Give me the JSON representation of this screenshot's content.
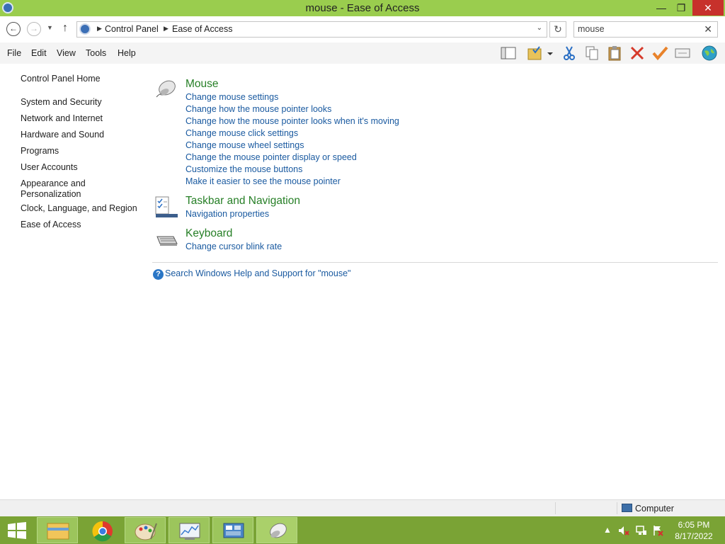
{
  "window": {
    "title": "mouse - Ease of Access",
    "minimize_glyph": "—",
    "maximize_glyph": "❐",
    "close_glyph": "✕"
  },
  "address": {
    "breadcrumbs": [
      "Control Panel",
      "Ease of Access"
    ],
    "search_value": "mouse"
  },
  "menu": [
    "File",
    "Edit",
    "View",
    "Tools",
    "Help"
  ],
  "toolbar_icons": [
    "layout-icon",
    "folder-options-icon",
    "cut-icon",
    "copy-icon",
    "paste-icon",
    "delete-icon",
    "checkmark-icon",
    "properties-icon",
    "globe-icon"
  ],
  "sidebar": {
    "home": "Control Panel Home",
    "items": [
      "System and Security",
      "Network and Internet",
      "Hardware and Sound",
      "Programs",
      "User Accounts",
      "Appearance and Personalization",
      "Clock, Language, and Region",
      "Ease of Access"
    ]
  },
  "results": [
    {
      "title": "Mouse",
      "icon": "mouse-icon",
      "links": [
        "Change mouse settings",
        "Change how the mouse pointer looks",
        "Change how the mouse pointer looks when it's moving",
        "Change mouse click settings",
        "Change mouse wheel settings",
        "Change the mouse pointer display or speed",
        "Customize the mouse buttons",
        "Make it easier to see the mouse pointer"
      ]
    },
    {
      "title": "Taskbar and Navigation",
      "icon": "taskbar-icon",
      "links": [
        "Navigation properties"
      ]
    },
    {
      "title": "Keyboard",
      "icon": "keyboard-icon",
      "links": [
        "Change cursor blink rate"
      ]
    }
  ],
  "help_link": "Search Windows Help and Support for \"mouse\"",
  "status": {
    "location": "Computer"
  },
  "taskbar": {
    "apps": [
      "file-explorer-icon",
      "chrome-icon",
      "paint-icon",
      "resource-monitor-icon",
      "control-panel-icon",
      "mouse-icon"
    ],
    "time": "6:05 PM",
    "date": "8/17/2022"
  },
  "colors": {
    "titlebar": "#9acd4e",
    "taskbar": "#7aa335",
    "link": "#1a5aa0",
    "group_title": "#267f26"
  }
}
